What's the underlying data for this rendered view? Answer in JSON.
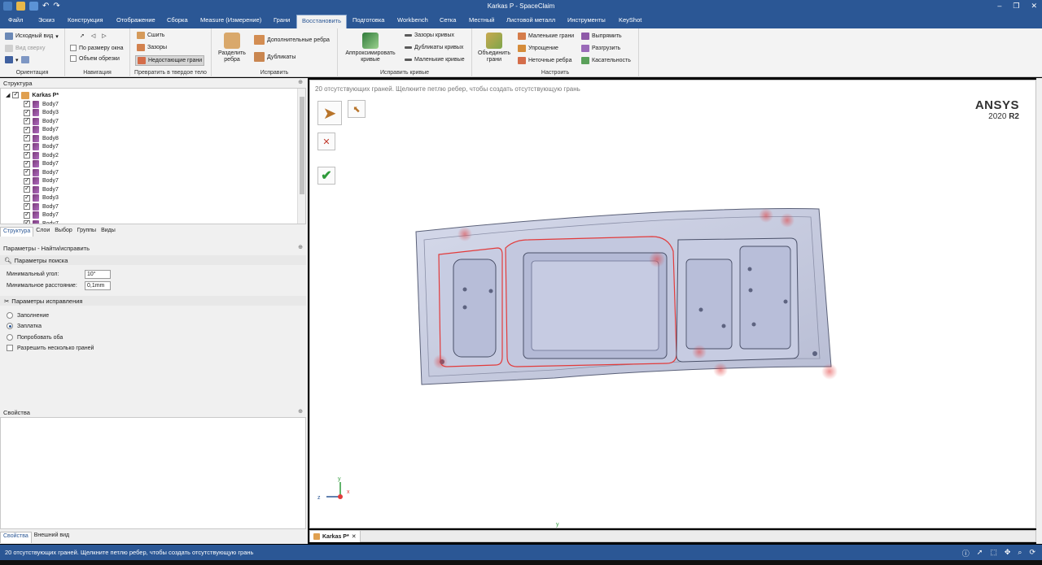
{
  "window": {
    "title": "Karkas P - SpaceClaim"
  },
  "menu": [
    {
      "label": "Файл"
    },
    {
      "label": "Эскиз"
    },
    {
      "label": "Конструкция"
    },
    {
      "label": "Отображение"
    },
    {
      "label": "Сборка"
    },
    {
      "label": "Measure (Измерение)"
    },
    {
      "label": "Грани"
    },
    {
      "label": "Восстановить"
    },
    {
      "label": "Подготовка"
    },
    {
      "label": "Workbench"
    },
    {
      "label": "Сетка"
    },
    {
      "label": "Местный"
    },
    {
      "label": "Листовой металл"
    },
    {
      "label": "Инструменты"
    },
    {
      "label": "KeyShot"
    }
  ],
  "menu_active": "Восстановить",
  "ribbon": {
    "orient": {
      "view_select": "Исходный вид",
      "view_top": "Вид сверху",
      "label": "Ориентация"
    },
    "nav": {
      "fit": "По размеру окна",
      "clip": "Объем обрезки",
      "label": "Навигация"
    },
    "solidify": {
      "stitch": "Сшить",
      "gaps": "Зазоры",
      "missing": "Недостающие грани",
      "label": "Превратить в твердое тело"
    },
    "fix": {
      "split": "Разделить ребра",
      "extra": "Дополнительные ребра",
      "dupes": "Дубликаты",
      "label": "Исправить"
    },
    "curves": {
      "approx": "Аппроксимировать кривые",
      "gaps": "Зазоры кривых",
      "dupes": "Дубликаты кривых",
      "small": "Маленькие кривые",
      "label": "Исправить кривые"
    },
    "adjust": {
      "merge": "Объединить грани",
      "small_faces": "Маленькие грани",
      "simplify": "Упрощение",
      "inexact": "Неточные ребра",
      "straighten": "Выпрямить",
      "relax": "Разгрузить",
      "tangency": "Касательность",
      "label": "Настроить"
    }
  },
  "structure": {
    "header": "Структура",
    "root": "Karkas P*",
    "bodies": [
      "Body7",
      "Body3",
      "Body7",
      "Body7",
      "Body8",
      "Body7",
      "Body2",
      "Body7",
      "Body7",
      "Body7",
      "Body7",
      "Body3",
      "Body7",
      "Body7",
      "Body7"
    ],
    "tabs": [
      "Структура",
      "Слои",
      "Выбор",
      "Группы",
      "Виды"
    ]
  },
  "params": {
    "header": "Параметры - Найти/исправить",
    "search_section": "Параметры поиска",
    "min_angle_label": "Минимальный угол:",
    "min_angle_value": "10°",
    "min_dist_label": "Минимальное расстояние:",
    "min_dist_value": "0,1mm",
    "fix_section": "Параметры исправления",
    "options": [
      {
        "label": "Заполнение",
        "type": "radio",
        "checked": false
      },
      {
        "label": "Заплатка",
        "type": "radio",
        "checked": true
      },
      {
        "label": "Попробовать оба",
        "type": "radio",
        "checked": false
      },
      {
        "label": "Разрешить несколько граней",
        "type": "checkbox",
        "checked": false
      }
    ]
  },
  "properties": {
    "header": "Свойства",
    "tabs": [
      "Свойства",
      "Внешний вид"
    ]
  },
  "viewport": {
    "hint": "20 отсутствующих граней. Щелкните петлю ребер, чтобы создать отсутствующую грань",
    "brand": "ANSYS",
    "version_prefix": "2020 ",
    "version_suffix": "R2",
    "axis_x": "x",
    "axis_y": "y",
    "axis_z": "z",
    "bottom_marker": "y"
  },
  "doc_tab": "Karkas P*",
  "status": {
    "text": "20 отсутствующих граней. Щелкните петлю ребер, чтобы создать отсутствующую грань"
  },
  "colors": {
    "accent": "#2b5795",
    "highlight_red": "#e23b3b",
    "model": "#c9cee3"
  }
}
